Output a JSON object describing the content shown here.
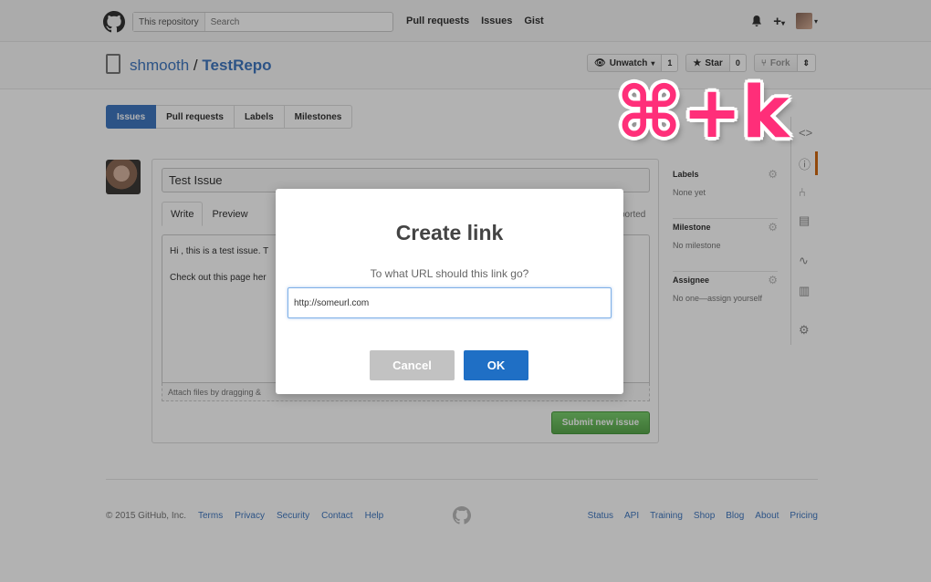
{
  "header": {
    "search_scope": "This repository",
    "search_placeholder": "Search",
    "nav": [
      "Pull requests",
      "Issues",
      "Gist"
    ],
    "plus_label": "+",
    "icons": [
      "github-logo-icon",
      "bell-icon",
      "plus-icon",
      "avatar"
    ]
  },
  "repo": {
    "owner": "shmooth",
    "separator": " / ",
    "name": "TestRepo",
    "watch_label": "Unwatch",
    "watch_count": "1",
    "star_label": "Star",
    "star_count": "0",
    "fork_label": "Fork",
    "fork_count": ""
  },
  "subnav": [
    "Issues",
    "Pull requests",
    "Labels",
    "Milestones"
  ],
  "issue": {
    "title": "Test Issue",
    "tabs": [
      "Write",
      "Preview"
    ],
    "markdown_note": "ported",
    "body_line1": "Hi , this is a test issue. T",
    "body_line2": "Check out this page her",
    "attach_text": "Attach files by dragging &",
    "submit_label": "Submit new issue"
  },
  "sidebar": {
    "labels_title": "Labels",
    "labels_value": "None yet",
    "milestone_title": "Milestone",
    "milestone_value": "No milestone",
    "assignee_title": "Assignee",
    "assignee_value": "No one—assign yourself"
  },
  "footer": {
    "copyright": "© 2015 GitHub, Inc.",
    "left_links": [
      "Terms",
      "Privacy",
      "Security",
      "Contact",
      "Help"
    ],
    "right_links": [
      "Status",
      "API",
      "Training",
      "Shop",
      "Blog",
      "About",
      "Pricing"
    ]
  },
  "modal": {
    "title": "Create link",
    "prompt": "To what URL should this link go?",
    "url_value": "http://someurl.com",
    "cancel_label": "Cancel",
    "ok_label": "OK"
  },
  "shortcut_badge": "⌘+k",
  "colors": {
    "accent": "#4078c0",
    "ok_button": "#1f6fc5",
    "shortcut": "#ff2e79",
    "submit": "#6cc644"
  }
}
